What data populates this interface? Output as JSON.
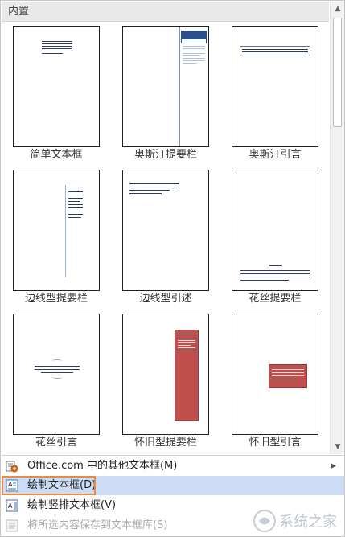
{
  "header": {
    "title": "内置"
  },
  "gallery": {
    "items": [
      {
        "label": "简单文本框"
      },
      {
        "label": "奥斯汀提要栏"
      },
      {
        "label": "奥斯汀引言"
      },
      {
        "label": "边线型提要栏"
      },
      {
        "label": "边线型引述"
      },
      {
        "label": "花丝提要栏"
      },
      {
        "label": "花丝引言"
      },
      {
        "label": "怀旧型提要栏"
      },
      {
        "label": "怀旧型引言"
      }
    ]
  },
  "menu": {
    "more_online": "Office.com 中的其他文本框(M)",
    "draw_textbox": "绘制文本框(D)",
    "draw_vertical_textbox": "绘制竖排文本框(V)",
    "save_selection": "将所选内容保存到文本框库(S)"
  },
  "scrollbar": {
    "up": "▲",
    "down": "▼"
  },
  "submenu_arrow": "▶",
  "watermark": {
    "text": "系统之家"
  },
  "colors": {
    "austin_blue": "#2b4f8a",
    "retro_red": "#c0504d",
    "highlight_orange": "#ec8a3a",
    "active_item_bg": "#cddcf5"
  },
  "icons": [
    "office-com-icon",
    "draw-textbox-icon",
    "draw-vertical-textbox-icon",
    "save-to-gallery-icon",
    "scroll-up-icon",
    "scroll-down-icon",
    "submenu-arrow-icon"
  ]
}
